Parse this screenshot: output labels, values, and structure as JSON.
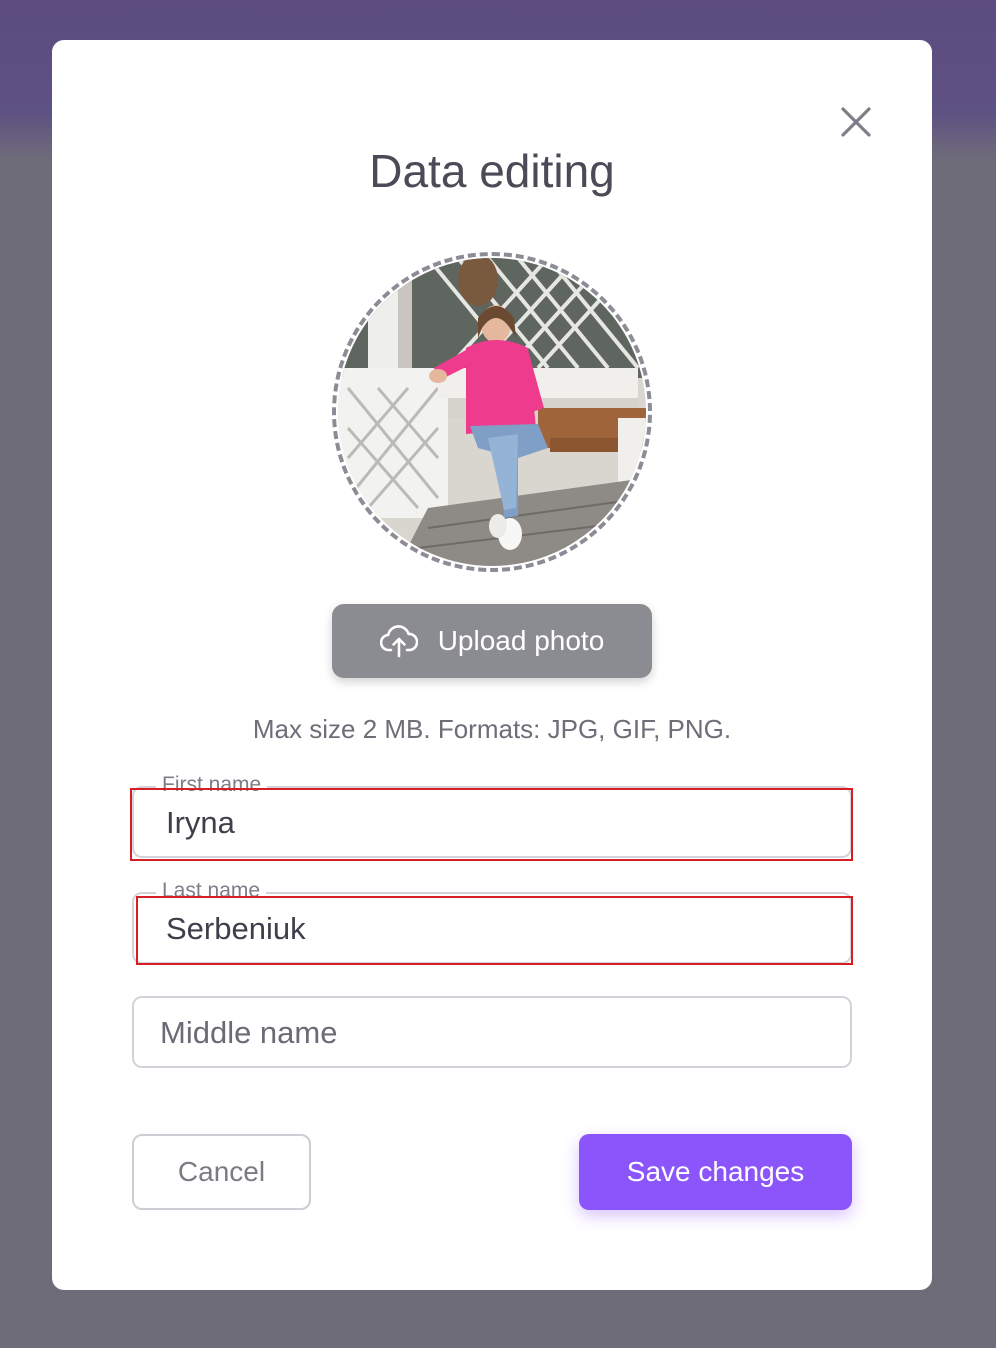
{
  "modal": {
    "title": "Data editing",
    "close_icon": "close-icon"
  },
  "avatar": {
    "icon": "profile-photo"
  },
  "upload": {
    "label": "Upload photo",
    "icon": "cloud-upload-icon",
    "hint": "Max size 2 MB. Formats: JPG, GIF, PNG."
  },
  "form": {
    "first_name": {
      "label": "First name",
      "value": "Iryna",
      "has_error": true
    },
    "last_name": {
      "label": "Last name",
      "value": "Serbeniuk",
      "has_error": true
    },
    "middle_name": {
      "placeholder": "Middle name",
      "value": ""
    }
  },
  "actions": {
    "cancel_label": "Cancel",
    "save_label": "Save changes"
  },
  "colors": {
    "accent": "#8b55fb",
    "upload_button": "#8b8b92",
    "error_outline": "#d61f25",
    "backdrop": "#6f6c79",
    "backdrop_top": "#5c4c80"
  }
}
